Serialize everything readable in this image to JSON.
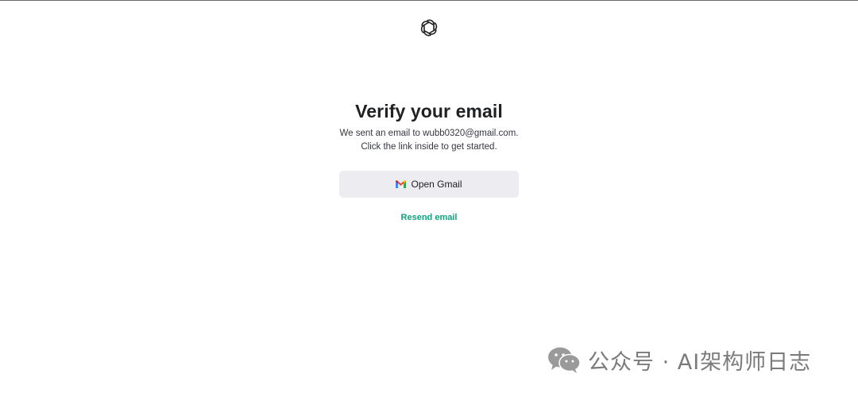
{
  "header": {
    "logo_icon": "openai-logo-icon"
  },
  "main": {
    "title": "Verify your email",
    "message_line1": "We sent an email to wubb0320@gmail.com.",
    "message_line2": "Click the link inside to get started.",
    "open_gmail_button": {
      "label": "Open Gmail",
      "icon": "gmail-icon"
    },
    "resend_link": "Resend email"
  },
  "watermark": {
    "icon": "wechat-icon",
    "text": "公众号 · AI架构师日志"
  },
  "colors": {
    "accent": "#10a37f",
    "button_bg": "#ececf1",
    "text_primary": "#202123",
    "text_secondary": "#353740",
    "watermark": "#7a7a7a"
  }
}
